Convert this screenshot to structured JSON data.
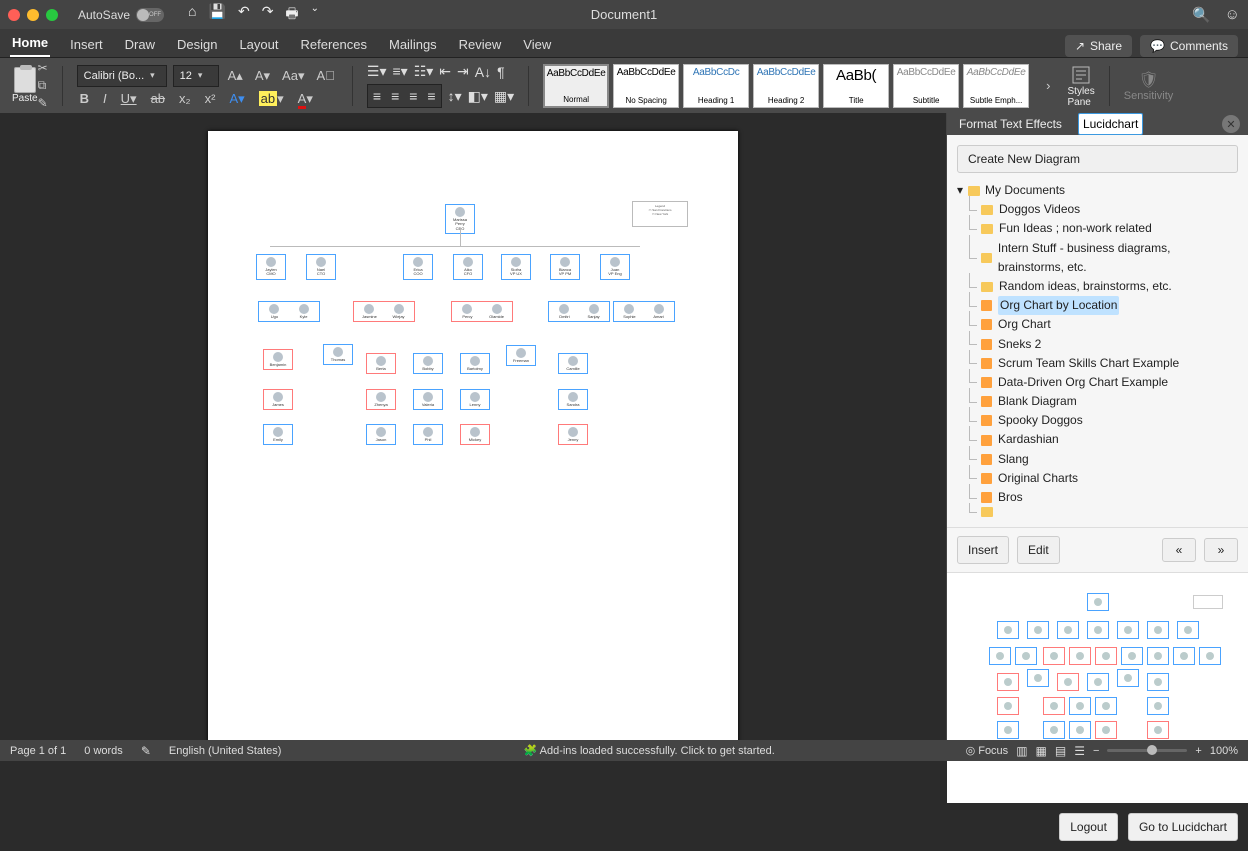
{
  "titlebar": {
    "autosave_label": "AutoSave",
    "autosave_state": "OFF",
    "doc_title": "Document1"
  },
  "tabs": {
    "items": [
      "Home",
      "Insert",
      "Draw",
      "Design",
      "Layout",
      "References",
      "Mailings",
      "Review",
      "View"
    ],
    "active": "Home",
    "share": "Share",
    "comments": "Comments"
  },
  "ribbon": {
    "paste": "Paste",
    "font_name": "Calibri (Bo...",
    "font_size": "12",
    "styles": [
      {
        "sample": "AaBbCcDdEe",
        "label": "Normal",
        "selected": true,
        "style": ""
      },
      {
        "sample": "AaBbCcDdEe",
        "label": "No Spacing",
        "style": ""
      },
      {
        "sample": "AaBbCcDc",
        "label": "Heading 1",
        "style": "color:#2e74b5;"
      },
      {
        "sample": "AaBbCcDdEe",
        "label": "Heading 2",
        "style": "color:#2e74b5;"
      },
      {
        "sample": "AaBb(",
        "label": "Title",
        "style": "font-size:15px;"
      },
      {
        "sample": "AaBbCcDdEe",
        "label": "Subtitle",
        "style": "color:#888;"
      },
      {
        "sample": "AaBbCcDdEe",
        "label": "Subtle Emph...",
        "style": "font-style:italic;color:#888;"
      }
    ],
    "styles_pane": "Styles\nPane",
    "sensitivity": "Sensitivity"
  },
  "sidepanel": {
    "tab1": "Format Text Effects",
    "tab2": "Lucidchart",
    "create": "Create New Diagram",
    "root": "My Documents",
    "docs": [
      "Doggos Videos",
      "Fun Ideas ; non-work related",
      "Intern Stuff - business diagrams, brainstorms, etc.",
      "Random ideas, brainstorms, etc.",
      "Org Chart by Location",
      "Org Chart",
      "Sneks 2",
      "Scrum Team Skills Chart Example",
      "Data-Driven Org Chart Example",
      "Blank Diagram",
      "Spooky Doggos",
      "Kardashian",
      "Slang",
      "Original Charts",
      "Bros"
    ],
    "selected_index": 4,
    "insert": "Insert",
    "edit": "Edit",
    "prev": "«",
    "next": "»",
    "logout": "Logout",
    "goto": "Go to Lucidchart"
  },
  "status": {
    "page": "Page 1 of 1",
    "words": "0 words",
    "lang": "English (United States)",
    "addins": "Add-ins loaded successfully. Click to get started.",
    "focus": "Focus",
    "zoom": "100%"
  },
  "chart_data": {
    "type": "tree",
    "title": "Org Chart by Location",
    "legend": {
      "title": "Legend",
      "items": [
        "San Francisco",
        "New York"
      ]
    },
    "note": "Boxes contain avatar + employee name + role; blue border = San Francisco, red border = New York."
  }
}
